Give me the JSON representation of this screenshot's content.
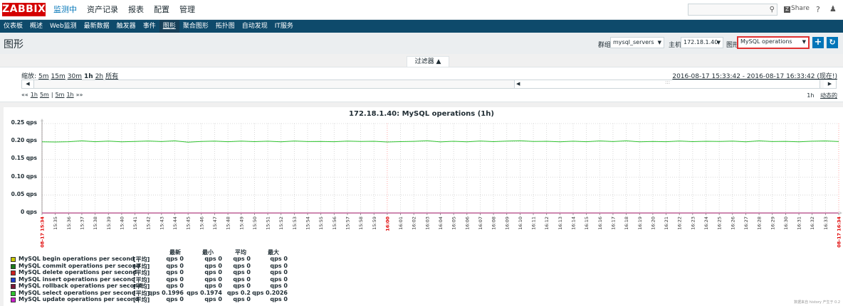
{
  "topbar": {
    "logo": "ZABBIX",
    "menu": [
      "监测中",
      "资产记录",
      "报表",
      "配置",
      "管理"
    ],
    "active_menu": 0,
    "search_icon": "search-icon",
    "share_label": "Share",
    "help_label": "?",
    "user_icon": "user-icon"
  },
  "submenu": {
    "items": [
      "仪表板",
      "概述",
      "Web监测",
      "最新数据",
      "触发器",
      "事件",
      "图形",
      "聚合图形",
      "拓扑图",
      "自动发现",
      "IT服务"
    ],
    "active": 6
  },
  "header": {
    "title": "图形",
    "group_label": "群组",
    "group_value": "mysql_servers",
    "host_label": "主机",
    "host_value": "172.18.1.40",
    "graph_label": "图形",
    "graph_value": "MySQL operations",
    "add_icon": "plus-icon",
    "refresh_icon": "refresh-icon"
  },
  "filter": {
    "tab_label": "过滤器 ▲",
    "zoom_label": "缩放:",
    "zoom_options": [
      "5m",
      "15m",
      "30m",
      "1h",
      "2h",
      "所有"
    ],
    "zoom_current": "1h",
    "period": "2016-08-17 15:33:42 - 2016-08-17 16:33:42 (现在!)",
    "nav_left": [
      "««",
      "1h",
      "5m",
      "|",
      "5m",
      "1h",
      "»»"
    ],
    "nav_right_period": "1h",
    "nav_right_mode": "动态的"
  },
  "chart_data": {
    "type": "line",
    "title": "172.18.1.40: MySQL operations (1h)",
    "ylim": [
      0,
      0.25
    ],
    "y_ticks": [
      "0.25 qps",
      "0.20 qps",
      "0.15 qps",
      "0.10 qps",
      "0.05 qps",
      "0 qps"
    ],
    "x_ticks": [
      "08-17 15:34",
      "15:35",
      "15:36",
      "15:37",
      "15:38",
      "15:39",
      "15:40",
      "15:41",
      "15:42",
      "15:43",
      "15:44",
      "15:45",
      "15:46",
      "15:47",
      "15:48",
      "15:49",
      "15:50",
      "15:51",
      "15:52",
      "15:53",
      "15:54",
      "15:55",
      "15:56",
      "15:57",
      "15:58",
      "15:59",
      "16:00",
      "16:01",
      "16:02",
      "16:03",
      "16:04",
      "16:05",
      "16:06",
      "16:07",
      "16:08",
      "16:09",
      "16:10",
      "16:11",
      "16:12",
      "16:13",
      "16:14",
      "16:15",
      "16:16",
      "16:17",
      "16:18",
      "16:19",
      "16:20",
      "16:21",
      "16:22",
      "16:23",
      "16:24",
      "16:25",
      "16:26",
      "16:27",
      "16:28",
      "16:29",
      "16:30",
      "16:31",
      "16:32",
      "16:33",
      "08-17 16:34"
    ],
    "x_ticks_red": [
      0,
      26,
      60
    ],
    "grid": true,
    "series": [
      {
        "name": "MySQL begin operations per second",
        "color": "#c8c800",
        "values": [
          0,
          0,
          0,
          0,
          0,
          0,
          0,
          0,
          0,
          0,
          0,
          0,
          0,
          0,
          0,
          0,
          0,
          0,
          0,
          0,
          0,
          0,
          0,
          0,
          0,
          0,
          0,
          0,
          0,
          0,
          0,
          0,
          0,
          0,
          0,
          0,
          0,
          0,
          0,
          0,
          0,
          0,
          0,
          0,
          0,
          0,
          0,
          0,
          0,
          0,
          0,
          0,
          0,
          0,
          0,
          0,
          0,
          0,
          0,
          0,
          0
        ]
      },
      {
        "name": "MySQL commit operations per second",
        "color": "#1a7a1a",
        "values": [
          0,
          0,
          0,
          0,
          0,
          0,
          0,
          0,
          0,
          0,
          0,
          0,
          0,
          0,
          0,
          0,
          0,
          0,
          0,
          0,
          0,
          0,
          0,
          0,
          0,
          0,
          0,
          0,
          0,
          0,
          0,
          0,
          0,
          0,
          0,
          0,
          0,
          0,
          0,
          0,
          0,
          0,
          0,
          0,
          0,
          0,
          0,
          0,
          0,
          0,
          0,
          0,
          0,
          0,
          0,
          0,
          0,
          0,
          0,
          0,
          0
        ]
      },
      {
        "name": "MySQL delete operations per second",
        "color": "#cc1f1f",
        "values": [
          0,
          0,
          0,
          0,
          0,
          0,
          0,
          0,
          0,
          0,
          0,
          0,
          0,
          0,
          0,
          0,
          0,
          0,
          0,
          0,
          0,
          0,
          0,
          0,
          0,
          0,
          0,
          0,
          0,
          0,
          0,
          0,
          0,
          0,
          0,
          0,
          0,
          0,
          0,
          0,
          0,
          0,
          0,
          0,
          0,
          0,
          0,
          0,
          0,
          0,
          0,
          0,
          0,
          0,
          0,
          0,
          0,
          0,
          0,
          0,
          0
        ]
      },
      {
        "name": "MySQL insert operations per second",
        "color": "#1f3fcc",
        "values": [
          0,
          0,
          0,
          0,
          0,
          0,
          0,
          0,
          0,
          0,
          0,
          0,
          0,
          0,
          0,
          0,
          0,
          0,
          0,
          0,
          0,
          0,
          0,
          0,
          0,
          0,
          0,
          0,
          0,
          0,
          0,
          0,
          0,
          0,
          0,
          0,
          0,
          0,
          0,
          0,
          0,
          0,
          0,
          0,
          0,
          0,
          0,
          0,
          0,
          0,
          0,
          0,
          0,
          0,
          0,
          0,
          0,
          0,
          0,
          0,
          0
        ]
      },
      {
        "name": "MySQL rollback operations per second",
        "color": "#7a1a3a",
        "values": [
          0,
          0,
          0,
          0,
          0,
          0,
          0,
          0,
          0,
          0,
          0,
          0,
          0,
          0,
          0,
          0,
          0,
          0,
          0,
          0,
          0,
          0,
          0,
          0,
          0,
          0,
          0,
          0,
          0,
          0,
          0,
          0,
          0,
          0,
          0,
          0,
          0,
          0,
          0,
          0,
          0,
          0,
          0,
          0,
          0,
          0,
          0,
          0,
          0,
          0,
          0,
          0,
          0,
          0,
          0,
          0,
          0,
          0,
          0,
          0,
          0
        ]
      },
      {
        "name": "MySQL select operations per second",
        "color": "#2fc32f",
        "values": [
          0.199,
          0.1985,
          0.1992,
          0.2015,
          0.1992,
          0.201,
          0.199,
          0.2,
          0.2012,
          0.1996,
          0.2016,
          0.198,
          0.1998,
          0.2008,
          0.1992,
          0.201,
          0.1994,
          0.2006,
          0.199,
          0.2012,
          0.1996,
          0.2,
          0.1992,
          0.201,
          0.1998,
          0.2004,
          0.1984,
          0.1994,
          0.2002,
          0.2018,
          0.1986,
          0.2004,
          0.199,
          0.2012,
          0.1994,
          0.2008,
          0.202,
          0.1998,
          0.2004,
          0.199,
          0.2006,
          0.1992,
          0.2014,
          0.1996,
          0.2016,
          0.1988,
          0.2,
          0.1992,
          0.2012,
          0.1994,
          0.2004,
          0.1998,
          0.201,
          0.199,
          0.2016,
          0.1996,
          0.2002,
          0.1988,
          0.2006,
          0.2014,
          0.1996
        ]
      },
      {
        "name": "MySQL update operations per second",
        "color": "#cc1fcc",
        "values": [
          0,
          0,
          0,
          0,
          0,
          0,
          0,
          0,
          0,
          0,
          0,
          0,
          0,
          0,
          0,
          0,
          0,
          0,
          0,
          0,
          0,
          0,
          0,
          0,
          0,
          0,
          0,
          0,
          0,
          0,
          0,
          0,
          0,
          0,
          0,
          0,
          0,
          0,
          0,
          0,
          0,
          0,
          0,
          0,
          0,
          0,
          0,
          0,
          0,
          0,
          0,
          0,
          0,
          0,
          0,
          0,
          0,
          0,
          0,
          0,
          0
        ]
      }
    ]
  },
  "legend": {
    "headers": [
      "最新",
      "最小",
      "平均",
      "最大"
    ],
    "func": "[平均]",
    "rows": [
      {
        "latest": "0 qps",
        "min": "0 qps",
        "avg": "0 qps",
        "max": "0 qps"
      },
      {
        "latest": "0 qps",
        "min": "0 qps",
        "avg": "0 qps",
        "max": "0 qps"
      },
      {
        "latest": "0 qps",
        "min": "0 qps",
        "avg": "0 qps",
        "max": "0 qps"
      },
      {
        "latest": "0 qps",
        "min": "0 qps",
        "avg": "0 qps",
        "max": "0 qps"
      },
      {
        "latest": "0 qps",
        "min": "0 qps",
        "avg": "0 qps",
        "max": "0 qps"
      },
      {
        "latest": "0.1996 qps",
        "min": "0.1974 qps",
        "avg": "0.2 qps",
        "max": "0.2026 qps"
      },
      {
        "latest": "0 qps",
        "min": "0 qps",
        "avg": "0 qps",
        "max": "0 qps"
      }
    ]
  },
  "footer": "数据来自 history  产生于 0.2"
}
